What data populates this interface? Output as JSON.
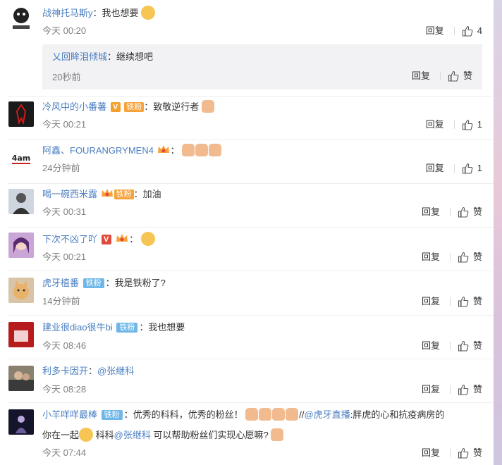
{
  "comments": [
    {
      "user": "战神托马斯y",
      "sep": "：",
      "text": "我也想要",
      "time": "今天 00:20",
      "reply_label": "回复",
      "likes": "4",
      "subreply": {
        "user": "乂回眸泪倾城",
        "sep": "：",
        "text": "继续想吧",
        "time": "20秒前",
        "reply_label": "回复",
        "likes": "赞"
      }
    },
    {
      "user": "冷风中的小番薯",
      "badge": "铁粉",
      "sep": "：",
      "text": "致敬逆行者",
      "time": "今天 00:21",
      "reply_label": "回复",
      "likes": "1"
    },
    {
      "user": "阿鑫、FOURANGRYMEN4",
      "sep": "：",
      "text": "",
      "time": "24分钟前",
      "reply_label": "回复",
      "likes": "1"
    },
    {
      "user": "喝一碗西米露",
      "badge": "铁粉",
      "sep": "：",
      "text": "加油",
      "time": "今天 00:31",
      "reply_label": "回复",
      "likes": "赞"
    },
    {
      "user": "下次不凶了吖",
      "sep": "：",
      "text": "",
      "time": "今天 00:21",
      "reply_label": "回复",
      "likes": "赞"
    },
    {
      "user": "虎牙植番",
      "badge": "铁粉",
      "sep": "：",
      "text": "我是铁粉了?",
      "time": "14分钟前",
      "reply_label": "回复",
      "likes": "赞"
    },
    {
      "user": "建业很diao很牛bi",
      "badge": "铁粉",
      "sep": "：",
      "text": "我也想要",
      "time": "今天 08:46",
      "reply_label": "回复",
      "likes": "赞"
    },
    {
      "user": "利多卡因开",
      "sep": "：",
      "text": "@张继科",
      "time": "今天 08:28",
      "reply_label": "回复",
      "likes": "赞"
    },
    {
      "user": "小羊咩咩最棒",
      "badge": "铁粉",
      "sep": "：",
      "text": "优秀的科科，优秀的粉丝！",
      "text_a": "//",
      "mention_a": "@虎牙直播",
      "text_b": ":胖虎的心和抗疫病房的",
      "line2_a": "你在一起",
      "line2_b": " 科科",
      "mention_b": "@张继科",
      "line2_c": " 可以帮助粉丝们实现心愿嘛?",
      "time": "今天 07:44",
      "reply_label": "回复",
      "likes": "赞"
    }
  ],
  "colors": {
    "username": "#eb7350",
    "username_alt": "#4b7fc1",
    "text": "#333333",
    "meta": "#808080",
    "fan_badge": "#6fb7e8"
  }
}
